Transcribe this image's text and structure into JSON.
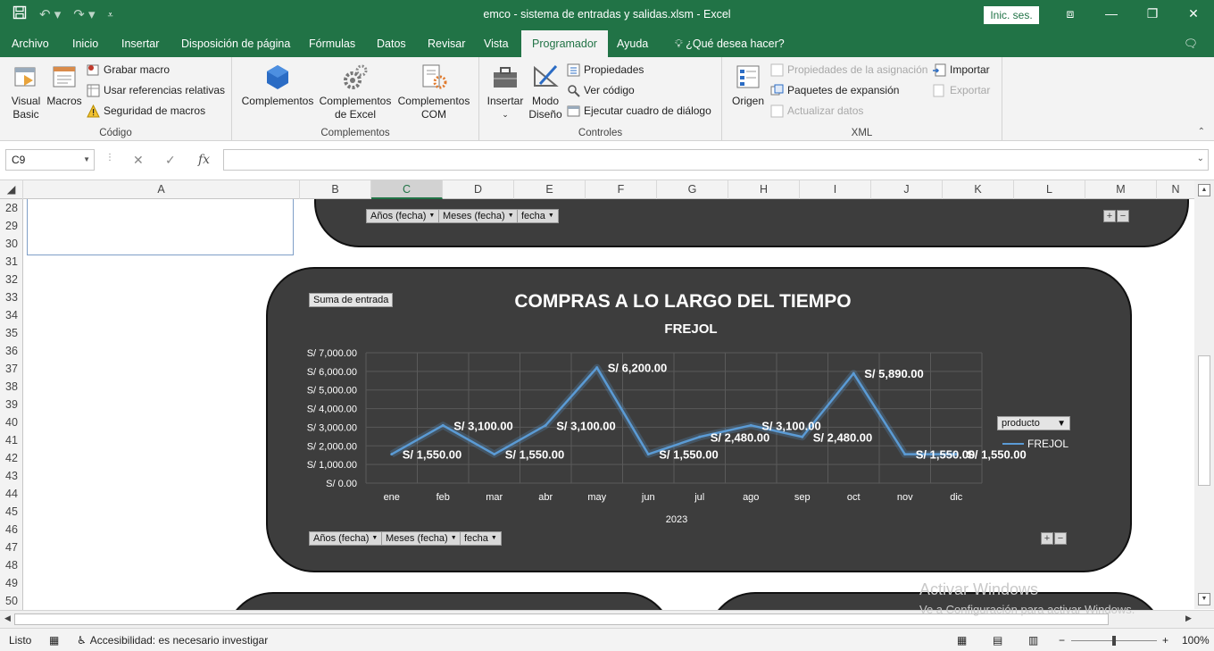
{
  "titlebar": {
    "title": "emco - sistema de entradas y salidas.xlsm  -  Excel",
    "signin": "Inic. ses."
  },
  "tabs": [
    "Archivo",
    "Inicio",
    "Insertar",
    "Disposición de página",
    "Fórmulas",
    "Datos",
    "Revisar",
    "Vista",
    "Programador",
    "Ayuda",
    "¿Qué desea hacer?"
  ],
  "active_tab": "Programador",
  "ribbon": {
    "codigo": {
      "label": "Código",
      "visual_basic_1": "Visual",
      "visual_basic_2": "Basic",
      "macros": "Macros",
      "grabar_macro": "Grabar macro",
      "usar_referencias": "Usar referencias relativas",
      "seguridad_macros": "Seguridad de macros"
    },
    "complementos": {
      "label": "Complementos",
      "complementos": "Complementos",
      "excel_1": "Complementos",
      "excel_2": "de Excel",
      "com_1": "Complementos",
      "com_2": "COM"
    },
    "controles": {
      "label": "Controles",
      "insertar": "Insertar",
      "modo_1": "Modo",
      "modo_2": "Diseño",
      "propiedades": "Propiedades",
      "ver_codigo": "Ver código",
      "ejecutar": "Ejecutar cuadro de diálogo"
    },
    "xml": {
      "label": "XML",
      "origen": "Origen",
      "propiedades_asignacion": "Propiedades de la asignación",
      "paquetes": "Paquetes de expansión",
      "actualizar": "Actualizar datos",
      "importar": "Importar",
      "exportar": "Exportar"
    }
  },
  "formula_bar": {
    "name_box": "C9",
    "fx": "fx",
    "formula": ""
  },
  "columns": [
    "A",
    "B",
    "C",
    "D",
    "E",
    "F",
    "G",
    "H",
    "I",
    "J",
    "K",
    "L",
    "M",
    "N"
  ],
  "selected_column": "C",
  "rows": [
    "28",
    "29",
    "30",
    "31",
    "32",
    "33",
    "34",
    "35",
    "36",
    "37",
    "38",
    "39",
    "40",
    "41",
    "42",
    "43",
    "44",
    "45",
    "46",
    "47",
    "48",
    "49",
    "50"
  ],
  "top_panel": {
    "buttons": [
      "Años (fecha)",
      "Meses (fecha)",
      "fecha"
    ],
    "plus": "+",
    "minus": "−"
  },
  "main_panel": {
    "value_field": "Suma de entrada",
    "buttons": [
      "Años (fecha)",
      "Meses (fecha)",
      "fecha"
    ],
    "plus": "+",
    "minus": "−",
    "legend_filter": "producto"
  },
  "chart_data": {
    "type": "line",
    "title": "COMPRAS A LO LARGO DEL TIEMPO",
    "subtitle": "FREJOL",
    "categories": [
      "ene",
      "feb",
      "mar",
      "abr",
      "may",
      "jun",
      "jul",
      "ago",
      "sep",
      "oct",
      "nov",
      "dic"
    ],
    "xlabel": "2023",
    "ylabel": "",
    "yticks": [
      "S/ 0.00",
      "S/ 1,000.00",
      "S/ 2,000.00",
      "S/ 3,000.00",
      "S/ 4,000.00",
      "S/ 5,000.00",
      "S/ 6,000.00",
      "S/ 7,000.00"
    ],
    "ylim": [
      0,
      7000
    ],
    "grid": true,
    "legend": "right",
    "series": [
      {
        "name": "FREJOL",
        "values": [
          1550,
          3100,
          1550,
          3100,
          6200,
          1550,
          2480,
          3100,
          2480,
          5890,
          1550,
          1550
        ],
        "labels": [
          "S/ 1,550.00",
          "S/ 3,100.00",
          "S/ 1,550.00",
          "S/ 3,100.00",
          "S/ 6,200.00",
          "S/ 1,550.00",
          "S/ 2,480.00",
          "S/ 3,100.00",
          "S/ 2,480.00",
          "S/ 5,890.00",
          "S/ 1,550.00",
          "S/ 1,550.00"
        ],
        "color": "#5b9bd5"
      }
    ]
  },
  "watermark": {
    "line1": "Activar Windows",
    "line2": "Ve a Configuración para activar Windows."
  },
  "statusbar": {
    "ready": "Listo",
    "accessibility": "Accesibilidad: es necesario investigar",
    "zoom": "100%"
  },
  "colors": {
    "excel_green": "#217346",
    "panel_bg": "#3d3d3d",
    "line": "#5b9bd5"
  }
}
